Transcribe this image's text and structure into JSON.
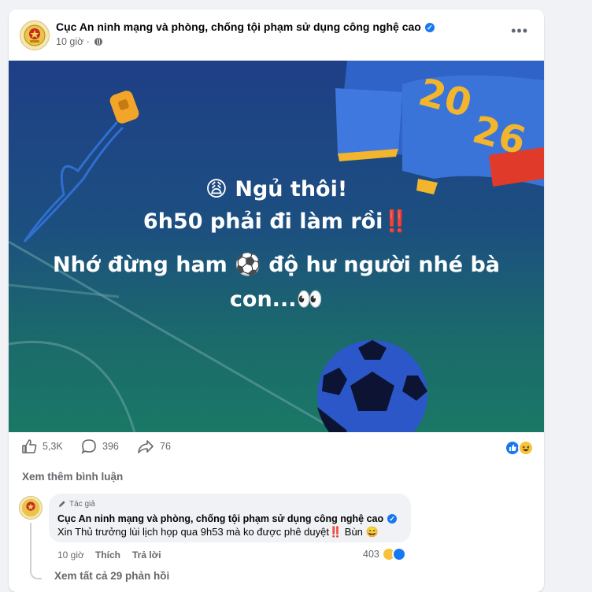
{
  "post": {
    "page_name": "Cục An ninh mạng và phòng, chống tội phạm sử dụng công nghệ cao",
    "time": "10 giờ",
    "more_label": "•••"
  },
  "image_text": {
    "line1": "😩 Ngủ thôi!",
    "line2": "6h50 phải đi làm rồi‼️",
    "line3": "Nhớ đừng ham ⚽ độ hư người nhé bà",
    "line4": "con...👀",
    "banner": [
      "20",
      "26"
    ]
  },
  "stats": {
    "likes": "5,3K",
    "comments": "396",
    "shares": "76",
    "reaction_icons": [
      "like-icon",
      "haha-icon"
    ]
  },
  "see_more_comments": "Xem thêm bình luận",
  "comment": {
    "role_badge": "Tác giả",
    "author": "Cục An ninh mạng và phòng, chống tội phạm sử dụng công nghệ cao",
    "text": "Xin Thủ trưởng lùi lịch họp qua 9h53 mà ko được phê duyệt‼️ Bùn 😄",
    "time": "10 giờ",
    "like_label": "Thích",
    "reply_label": "Trả lời",
    "reaction_count": "403"
  },
  "view_all_replies": "Xem tất cả 29 phản hồi",
  "colors": {
    "accent": "#1877f2",
    "secondary_text": "#65676b",
    "hero_top": "#1f3f86",
    "hero_bottom": "#1a7866"
  }
}
